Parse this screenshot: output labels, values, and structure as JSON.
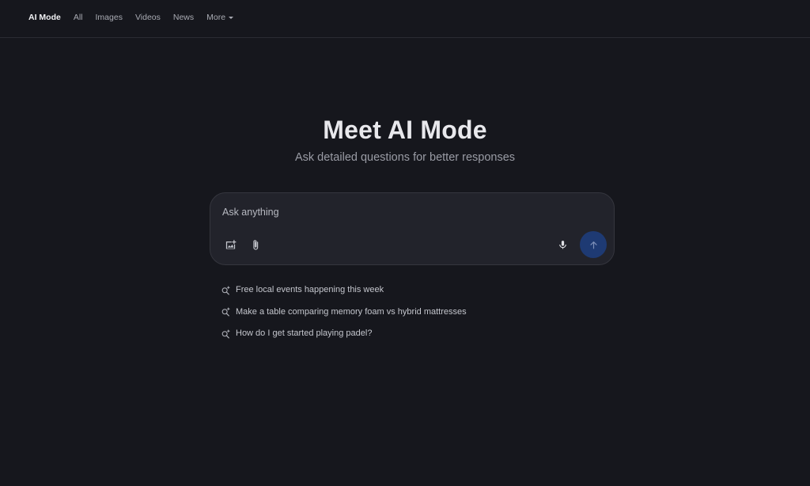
{
  "nav": {
    "items": [
      {
        "label": "AI Mode",
        "active": true
      },
      {
        "label": "All",
        "active": false
      },
      {
        "label": "Images",
        "active": false
      },
      {
        "label": "Videos",
        "active": false
      },
      {
        "label": "News",
        "active": false
      },
      {
        "label": "More",
        "active": false,
        "dropdown": true
      }
    ]
  },
  "hero": {
    "title": "Meet AI Mode",
    "subtitle": "Ask detailed questions for better responses"
  },
  "search": {
    "placeholder": "Ask anything",
    "value": "",
    "icons": {
      "image": "add-image-icon",
      "attach": "paperclip-icon",
      "mic": "microphone-icon",
      "send": "arrow-up-icon"
    },
    "send_color": "#1e3a73"
  },
  "suggestions": [
    {
      "text": "Free local events happening this week",
      "icon": "search-sparkle-icon"
    },
    {
      "text": "Make a table comparing memory foam vs hybrid mattresses",
      "icon": "search-sparkle-icon"
    },
    {
      "text": "How do I get started playing padel?",
      "icon": "search-sparkle-icon"
    }
  ],
  "colors": {
    "background": "#16171d",
    "search_box": "#22232b",
    "text_primary": "#e8e8ec",
    "text_secondary": "#9a9ca5"
  }
}
